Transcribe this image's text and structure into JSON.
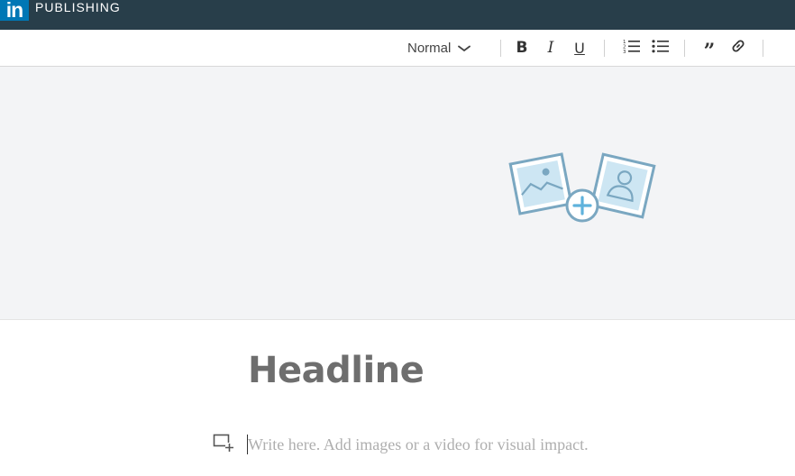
{
  "header": {
    "logo_text": "in",
    "brand": "PUBLISHING"
  },
  "toolbar": {
    "style_select": "Normal",
    "bold": "B",
    "italic": "I",
    "underline": "U",
    "quote": "”",
    "icons": [
      "chevron-down-icon",
      "numbered-list-icon",
      "bulleted-list-icon",
      "quote-icon",
      "link-icon"
    ]
  },
  "cover": {
    "icon": "add-cover-image-icon"
  },
  "editor": {
    "headline_placeholder": "Headline",
    "body_placeholder": "Write here. Add images or a video for visual impact."
  },
  "colors": {
    "topbar": "#283e4a",
    "logo": "#0077b5",
    "cover_bg": "#f3f4f6",
    "illustration_stroke": "#7aa7c1",
    "illustration_fill": "#cde6f3"
  }
}
